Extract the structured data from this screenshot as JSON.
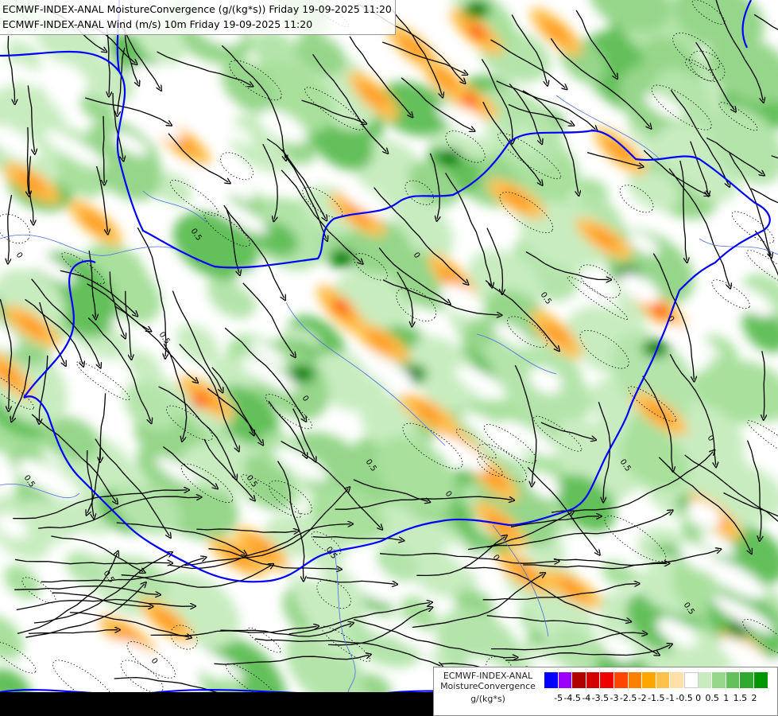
{
  "title": {
    "line1": "ECMWF-INDEX-ANAL MoistureConvergence (g/(kg*s)) Friday 19-09-2025 11:20",
    "line2": "ECMWF-INDEX-ANAL Wind (m/s) 10m Friday 19-09-2025 11:20"
  },
  "legend": {
    "title_line1": "ECMWF-INDEX-ANAL",
    "title_line2": "MoistureConvergence",
    "title_line3": "g/(kg*s)",
    "colors": [
      "#0000ff",
      "#9b00ff",
      "#b00000",
      "#d40000",
      "#f00000",
      "#ff4500",
      "#ff7f00",
      "#ffa500",
      "#ffc04d",
      "#ffe0a8",
      "#ffffff",
      "#c8ecc0",
      "#96d68a",
      "#64c05a",
      "#2faa2f",
      "#009600"
    ],
    "tick_labels": [
      "-5",
      "-4.5",
      "-4",
      "-3.5",
      "-3",
      "-2.5",
      "-2",
      "-1.5",
      "-1",
      "-0.5",
      "0",
      "0.5",
      "1",
      "1.5",
      "2"
    ]
  },
  "contour_labels": [
    "0",
    "0.5",
    "0",
    "0.5",
    "0",
    "0.5",
    "0",
    "0.5",
    "0.5",
    "0",
    "0.5",
    "0",
    "0.5",
    "0.5",
    "0",
    "0.5",
    "0",
    "0.5"
  ],
  "map": {
    "border_color": "#0000ff",
    "river_color": "#4a6ee0",
    "streamline_color": "#000000"
  }
}
